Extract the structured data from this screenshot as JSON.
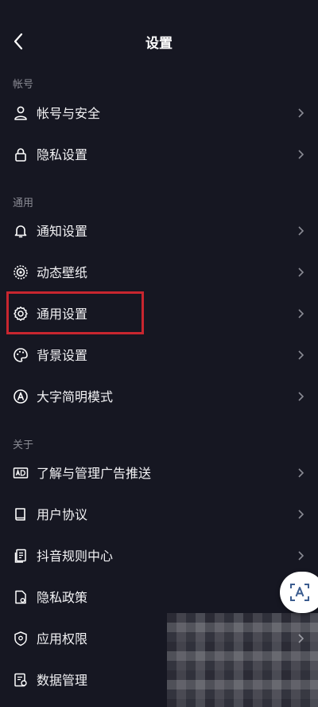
{
  "header": {
    "title": "设置",
    "back_icon": "back-arrow-icon"
  },
  "sections": {
    "account": {
      "label": "帐号",
      "items": [
        {
          "label": "帐号与安全",
          "icon": "user-icon"
        },
        {
          "label": "隐私设置",
          "icon": "lock-icon"
        }
      ]
    },
    "general": {
      "label": "通用",
      "items": [
        {
          "label": "通知设置",
          "icon": "bell-icon"
        },
        {
          "label": "动态壁纸",
          "icon": "live-wallpaper-icon"
        },
        {
          "label": "通用设置",
          "icon": "gear-icon"
        },
        {
          "label": "背景设置",
          "icon": "palette-icon"
        },
        {
          "label": "大字简明模式",
          "icon": "large-text-icon"
        }
      ]
    },
    "about": {
      "label": "关于",
      "items": [
        {
          "label": "了解与管理广告推送",
          "icon": "ad-icon"
        },
        {
          "label": "用户协议",
          "icon": "book-icon"
        },
        {
          "label": "抖音规则中心",
          "icon": "rules-icon"
        },
        {
          "label": "隐私政策",
          "icon": "policy-icon"
        },
        {
          "label": "应用权限",
          "icon": "shield-icon"
        },
        {
          "label": "数据管理",
          "icon": "data-icon"
        }
      ]
    }
  },
  "colors": {
    "background": "#161722",
    "highlight": "#c8262f",
    "secondary_text": "#8a8b94"
  }
}
